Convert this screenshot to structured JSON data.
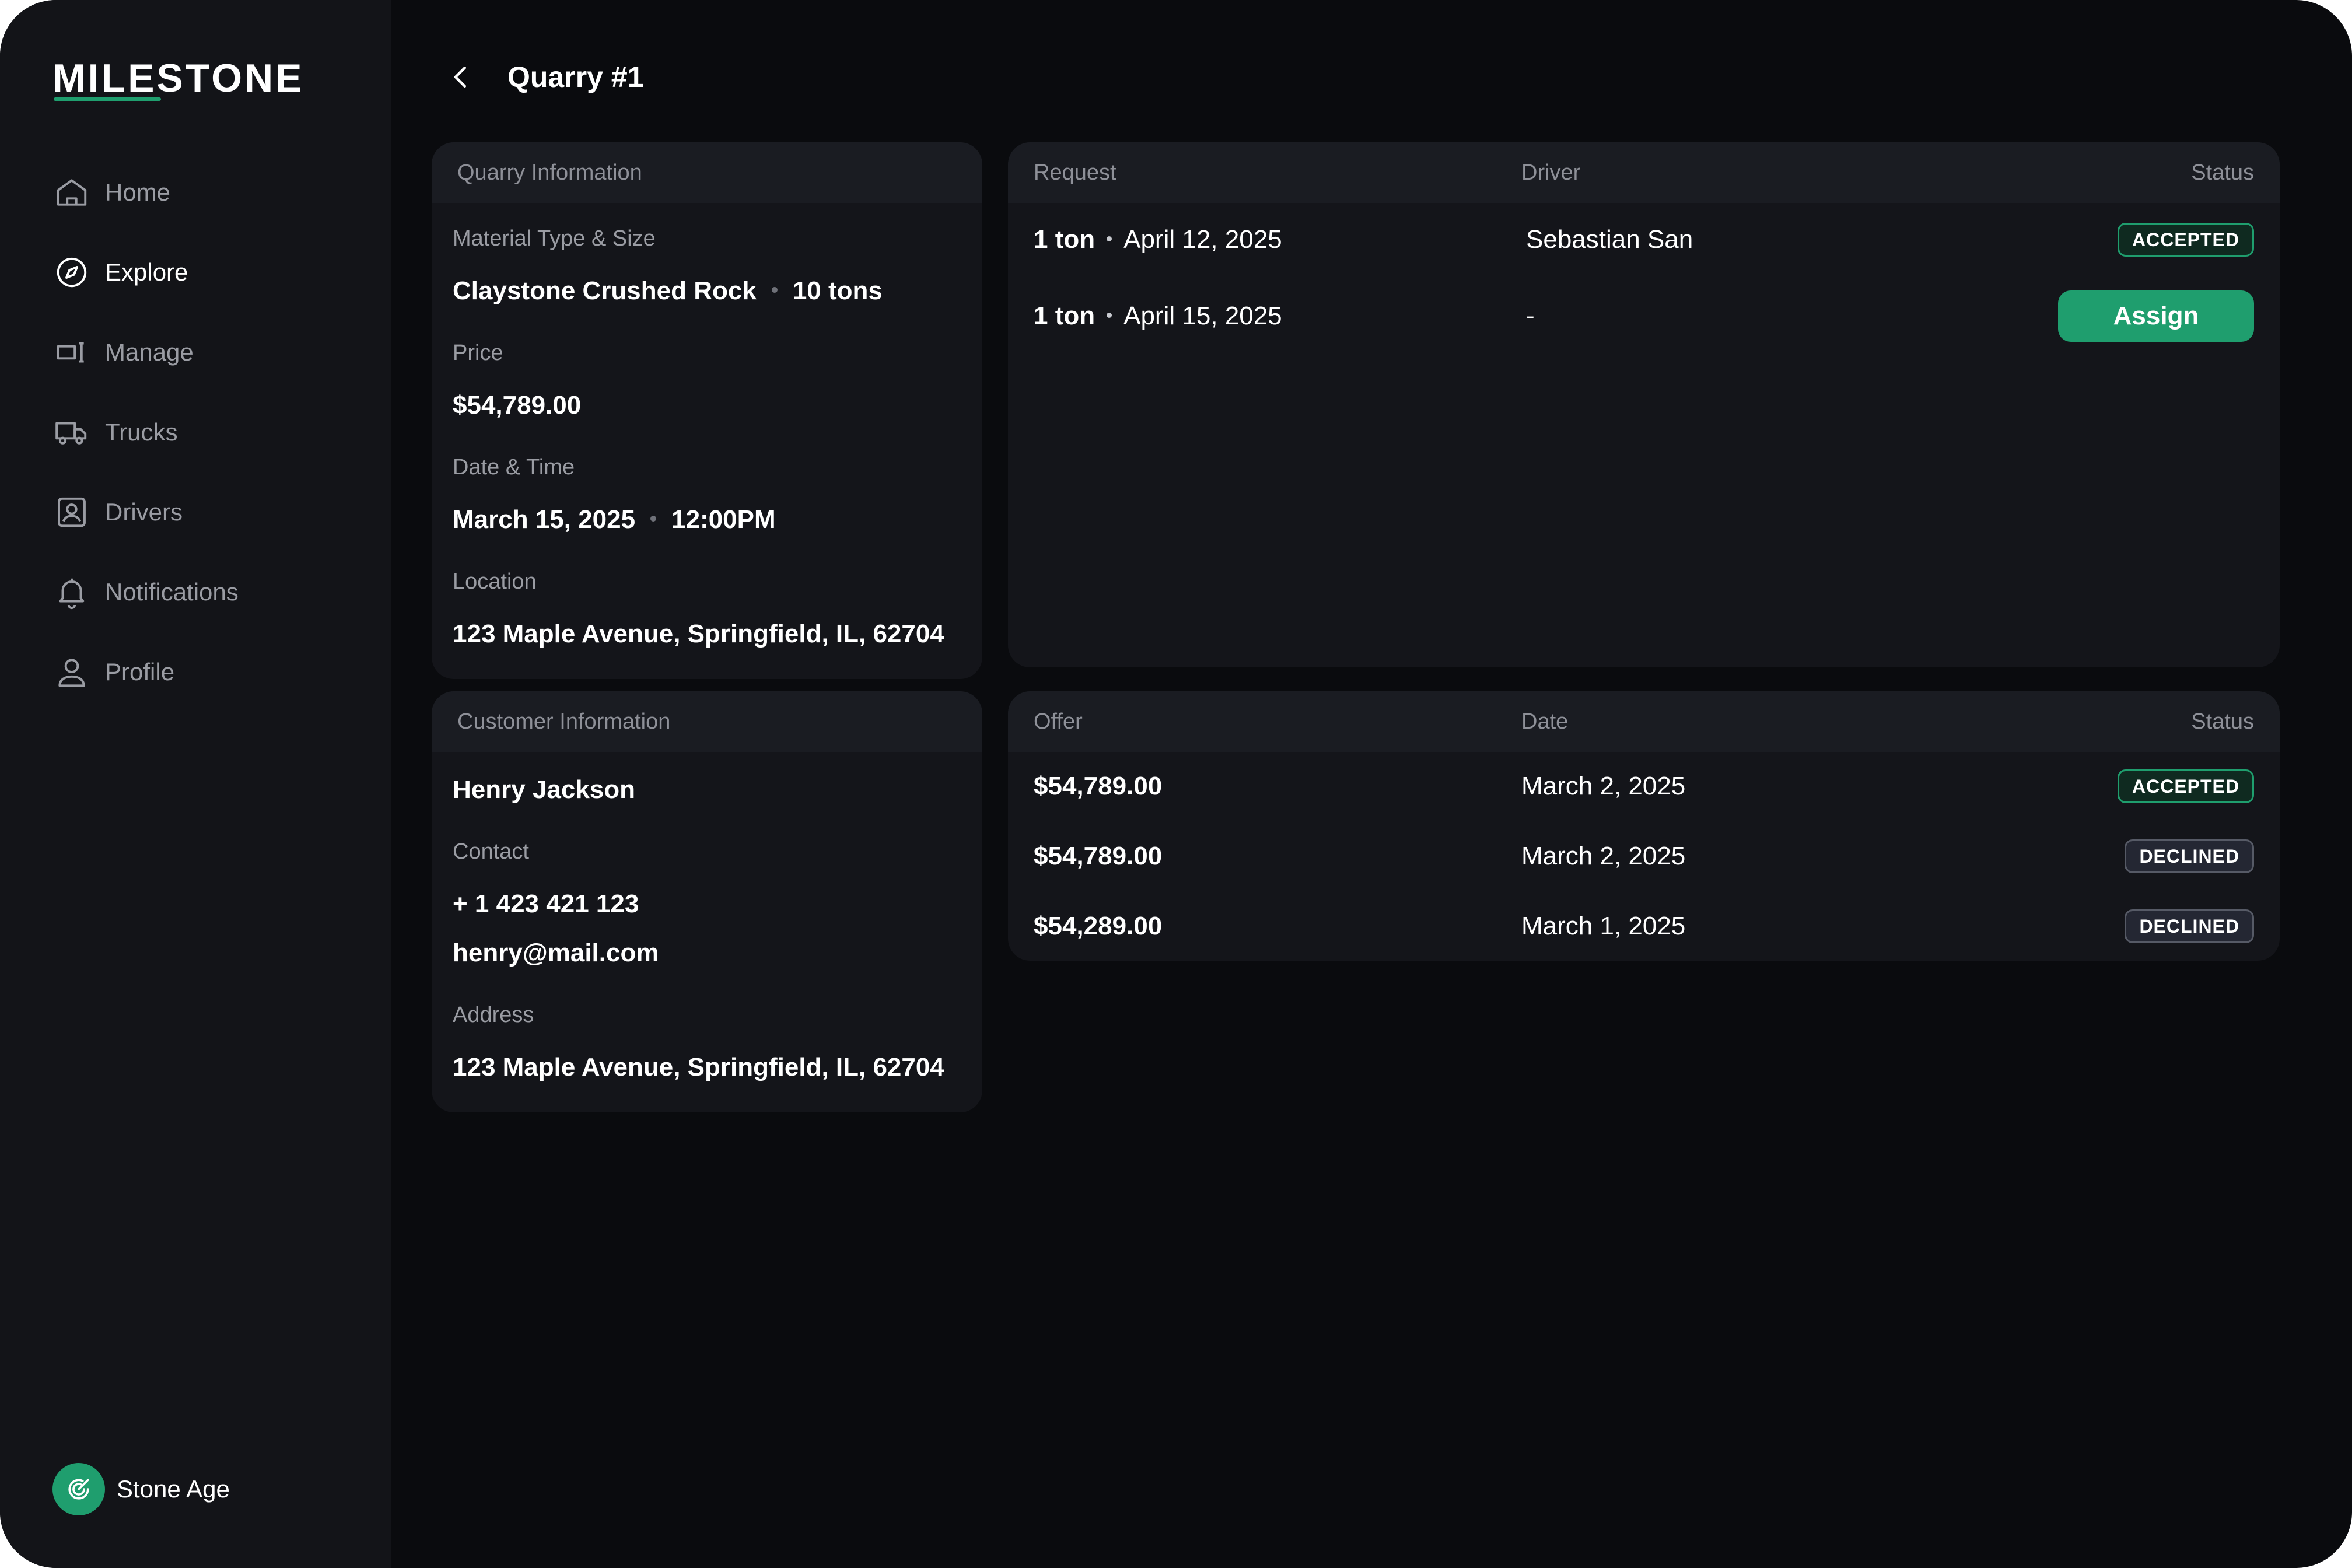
{
  "app": {
    "logo": "MILESTONE"
  },
  "sidebar": {
    "items": [
      {
        "label": "Home",
        "icon": "home-icon"
      },
      {
        "label": "Explore",
        "icon": "compass-icon",
        "active": true
      },
      {
        "label": "Manage",
        "icon": "manage-icon"
      },
      {
        "label": "Trucks",
        "icon": "truck-icon"
      },
      {
        "label": "Drivers",
        "icon": "driver-badge-icon"
      },
      {
        "label": "Notifications",
        "icon": "bell-icon"
      },
      {
        "label": "Profile",
        "icon": "user-icon"
      }
    ],
    "account": {
      "name": "Stone Age",
      "icon": "company-logo-icon"
    }
  },
  "header": {
    "title": "Quarry #1"
  },
  "quarry_info": {
    "title": "Quarry Information",
    "material_label": "Material Type & Size",
    "material": "Claystone Crushed Rock",
    "size": "10 tons",
    "price_label": "Price",
    "price": "$54,789.00",
    "datetime_label": "Date & Time",
    "date": "March 15, 2025",
    "time": "12:00PM",
    "location_label": "Location",
    "location": "123 Maple Avenue, Springfield, IL, 62704"
  },
  "customer_info": {
    "title": "Customer Information",
    "name": "Henry Jackson",
    "contact_label": "Contact",
    "phone": "+ 1 423 421 123",
    "email": "henry@mail.com",
    "address_label": "Address",
    "address": "123 Maple Avenue, Springfield, IL, 62704"
  },
  "requests": {
    "headers": [
      "Request",
      "Driver",
      "Status"
    ],
    "rows": [
      {
        "amount": "1 ton",
        "date": "April 12, 2025",
        "driver": "Sebastian San",
        "status": "ACCEPTED"
      },
      {
        "amount": "1 ton",
        "date": "April 15, 2025",
        "driver": "-",
        "action": "Assign"
      }
    ]
  },
  "offers": {
    "headers": [
      "Offer",
      "Date",
      "Status"
    ],
    "rows": [
      {
        "offer": "$54,789.00",
        "date": "March 2, 2025",
        "status": "ACCEPTED"
      },
      {
        "offer": "$54,789.00",
        "date": "March 2, 2025",
        "status": "DECLINED"
      },
      {
        "offer": "$54,289.00",
        "date": "March 1, 2025",
        "status": "DECLINED"
      }
    ]
  },
  "colors": {
    "accent": "#1f9e6e",
    "background": "#0a0b0e",
    "sidebar": "#131418",
    "card": "#14151a"
  }
}
